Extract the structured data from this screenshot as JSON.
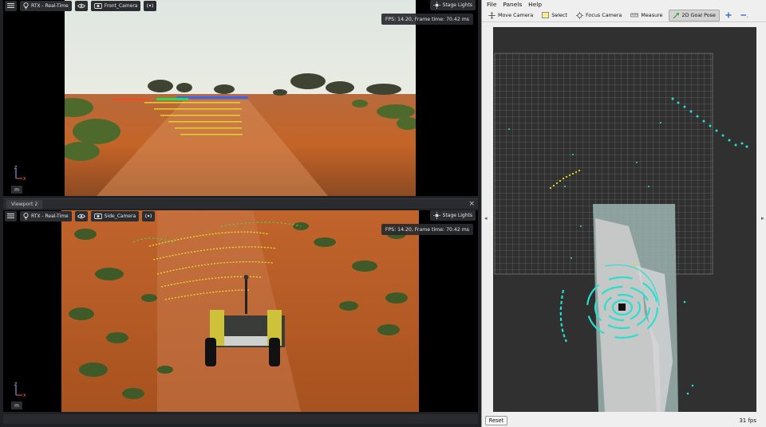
{
  "viewport1": {
    "settings_icon": "hamburger-settings-icon",
    "renderer": "RTX - Real-Time",
    "camera": "Front_Camera",
    "stage_lights": "Stage Lights",
    "fps": "FPS: 14.20, Frame time: 70.42 ms",
    "unit": "m"
  },
  "viewport2": {
    "tab": "Viewport 2",
    "close": "×",
    "renderer": "RTX - Real-Time",
    "camera": "Side_Camera",
    "stage_lights": "Stage Lights",
    "fps": "FPS: 14.20, Frame time: 70.42 ms",
    "unit": "m"
  },
  "rviz": {
    "menu": [
      "File",
      "Panels",
      "Help"
    ],
    "tools": [
      {
        "label": "Move Camera",
        "icon": "move-camera-icon"
      },
      {
        "label": "Select",
        "icon": "select-icon"
      },
      {
        "label": "Focus Camera",
        "icon": "focus-camera-icon"
      },
      {
        "label": "Measure",
        "icon": "measure-icon"
      },
      {
        "label": "2D Goal Pose",
        "icon": "goal-pose-icon",
        "active": true
      }
    ],
    "reset": "Reset",
    "fps": "31 fps"
  },
  "colors": {
    "rviz_bg": "#303030",
    "grid": "#8c8c8c",
    "lidar": "#27e0d0",
    "path": "#e4e41c",
    "sky": "#dfe6df",
    "soil": "#c46427"
  }
}
